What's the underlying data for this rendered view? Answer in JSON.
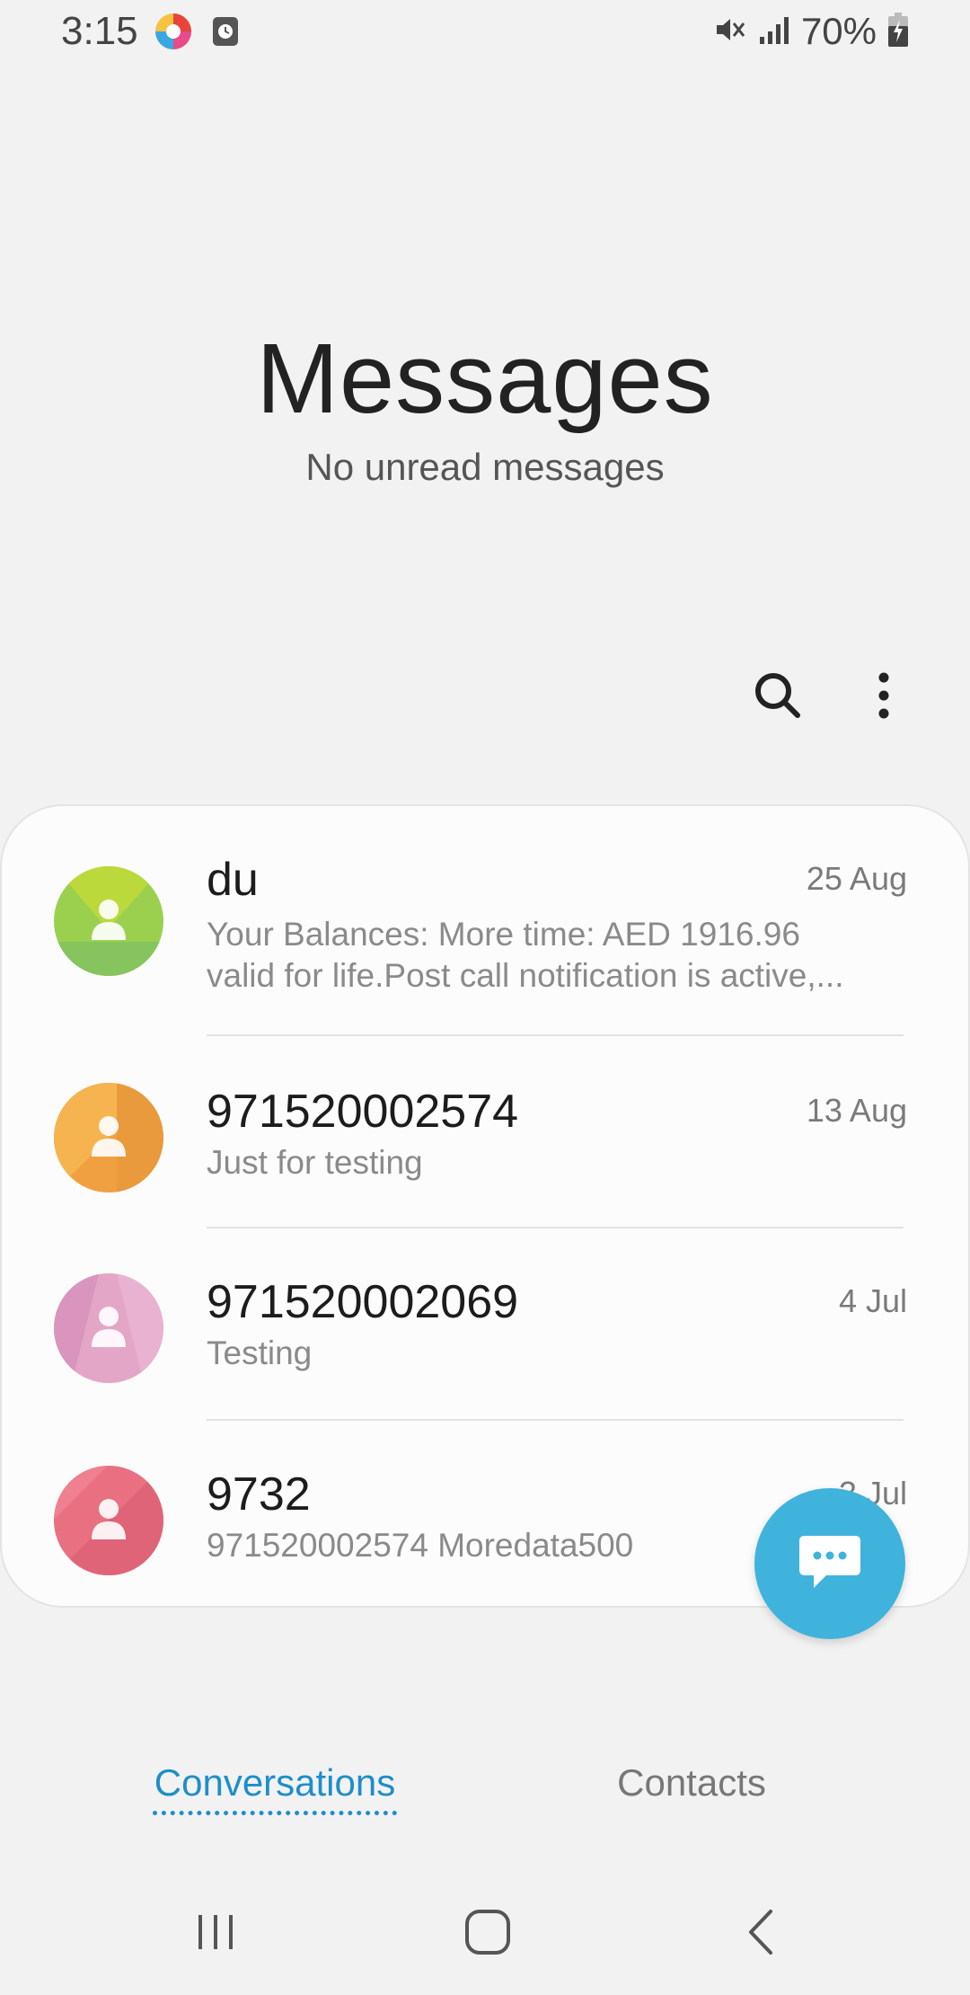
{
  "status_bar": {
    "time": "3:15",
    "battery_percent": "70%",
    "icons": [
      "app-notification-icon",
      "clock-app-icon",
      "mute-icon",
      "signal-icon",
      "battery-charging-icon"
    ]
  },
  "header": {
    "title": "Messages",
    "subtitle": "No unread messages"
  },
  "toolbar": {
    "icons": [
      "search-icon",
      "more-options-icon"
    ]
  },
  "conversations": [
    {
      "name": "du",
      "date": "25 Aug",
      "preview_line1": "Your Balances: More time: AED 1916.96",
      "preview_line2": "valid for life.Post call notification is active,...",
      "avatar_color": "#9bd04f"
    },
    {
      "name": "971520002574",
      "date": "13 Aug",
      "preview_line1": "Just for testing",
      "avatar_color": "#f0a040"
    },
    {
      "name": "971520002069",
      "date": "4 Jul",
      "preview_line1": "Testing",
      "avatar_color": "#e0a0c8"
    },
    {
      "name": "9732",
      "date": "3 Jul",
      "preview_line1": "971520002574 Moredata500",
      "avatar_color": "#e87080"
    }
  ],
  "fab": {
    "icon": "compose-message-icon",
    "color": "#3fb3dc"
  },
  "tabs": [
    {
      "label": "Conversations",
      "active": true
    },
    {
      "label": "Contacts",
      "active": false
    }
  ],
  "colors": {
    "accent": "#1e8ec9",
    "background": "#f2f2f2"
  },
  "nav_bar": {
    "icons": [
      "recents-icon",
      "home-icon",
      "back-icon"
    ]
  }
}
